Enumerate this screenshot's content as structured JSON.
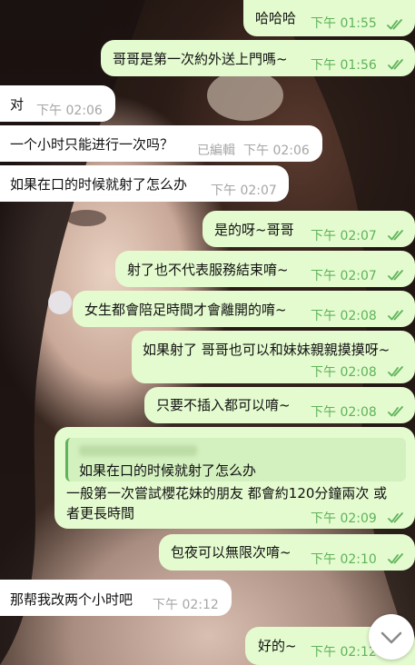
{
  "colors": {
    "outgoing_bubble": "#e4fbcf",
    "incoming_bubble": "#ffffff",
    "time_out": "#5fb35a",
    "time_in": "#a6a6a6"
  },
  "messages": [
    {
      "text": "哈哈哈",
      "time": "下午 01:55",
      "dir": "out",
      "read": true
    },
    {
      "text": "哥哥是第一次約外送上門嗎~",
      "time": "下午 01:56",
      "dir": "out",
      "read": true
    },
    {
      "text": "对",
      "time": "下午 02:06",
      "dir": "in"
    },
    {
      "text": "一个小时只能进行一次吗？",
      "edited": "已編輯",
      "time": "下午 02:06",
      "dir": "in"
    },
    {
      "text": "如果在口的时候就射了怎么办",
      "time": "下午 02:07",
      "dir": "in"
    },
    {
      "text": "是的呀~哥哥",
      "time": "下午 02:07",
      "dir": "out",
      "read": true
    },
    {
      "text": "射了也不代表服務結束唷~",
      "time": "下午 02:07",
      "dir": "out",
      "read": true
    },
    {
      "text": "女生都會陪足時間才會離開的唷~",
      "time": "下午 02:08",
      "dir": "out",
      "read": true
    },
    {
      "text": "如果射了 哥哥也可以和妹妹親親摸摸呀~",
      "time": "下午 02:08",
      "dir": "out",
      "read": true
    },
    {
      "text": "只要不插入都可以唷~",
      "time": "下午 02:08",
      "dir": "out",
      "read": true
    },
    {
      "quote": "如果在口的时候就射了怎么办",
      "text_line1": "一般第一次嘗試櫻花妹的朋友 都會約120分鐘兩次 或",
      "text_line2": "者更長時間",
      "time": "下午 02:09",
      "dir": "out",
      "read": true
    },
    {
      "text": "包夜可以無限次唷~",
      "time": "下午 02:10",
      "dir": "out",
      "read": true
    },
    {
      "text": "那帮我改两个小时吧",
      "time": "下午 02:12",
      "dir": "in"
    },
    {
      "text": "好的~",
      "time": "下午 02:12",
      "dir": "out",
      "read": true
    }
  ],
  "scroll_button_icon": "chevron-down-icon"
}
